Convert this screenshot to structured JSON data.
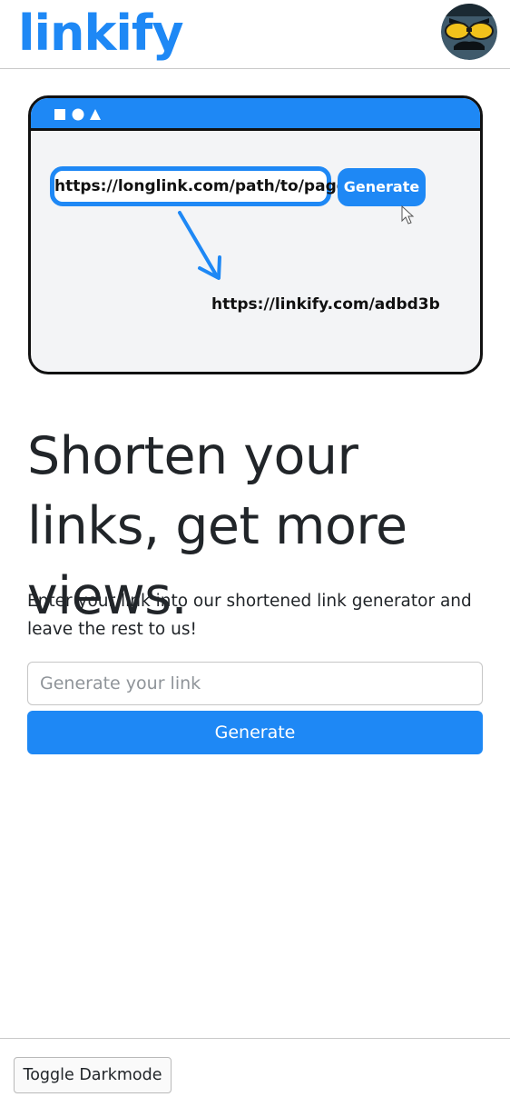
{
  "brand": {
    "name": "linkify",
    "color": "#1e88f5"
  },
  "user": {
    "avatar_icon": "sunglasses-face-avatar-icon"
  },
  "illustration": {
    "window_controls": [
      "square-icon",
      "circle-icon",
      "triangle-icon"
    ],
    "long_url": "https://longlink.com/path/to/page",
    "button_label": "Generate",
    "short_url": "https://linkify.com/adbd3b",
    "arrow_icon": "arrow-down-right-icon",
    "cursor_icon": "mouse-cursor-icon"
  },
  "hero": {
    "headline": "Shorten your links, get more views.",
    "lead": "Enter your link into our shortened link generator and leave the rest to us!"
  },
  "form": {
    "input_placeholder": "Generate your link",
    "input_value": "",
    "submit_label": "Generate"
  },
  "footer": {
    "toggle_label": "Toggle Darkmode"
  }
}
